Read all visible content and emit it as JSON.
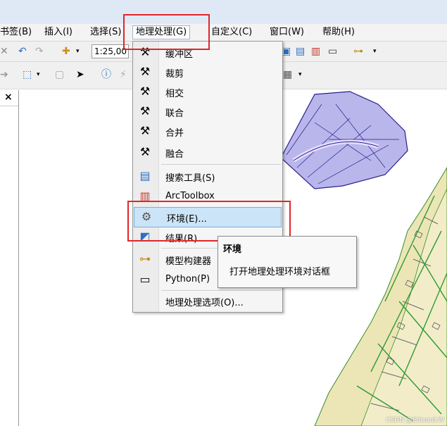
{
  "menubar": {
    "items": [
      "书签(B)",
      "插入(I)",
      "选择(S)",
      "地理处理(G)",
      "自定义(C)",
      "窗口(W)",
      "帮助(H)"
    ]
  },
  "toolbar": {
    "scale_value": "1:25,00"
  },
  "toc": {
    "close_glyph": "×"
  },
  "geoprocessing_menu": {
    "items": [
      {
        "label": "缓冲区",
        "icon": "hammer-icon"
      },
      {
        "label": "裁剪",
        "icon": "hammer-icon"
      },
      {
        "label": "相交",
        "icon": "hammer-icon"
      },
      {
        "label": "联合",
        "icon": "hammer-icon"
      },
      {
        "label": "合并",
        "icon": "hammer-icon"
      },
      {
        "label": "融合",
        "icon": "hammer-icon"
      },
      {
        "label": "搜索工具(S)",
        "icon": "search-window-icon"
      },
      {
        "label": "ArcToolbox",
        "icon": "toolbox-icon"
      },
      {
        "label": "环境(E)...",
        "icon": "tools-wrench-icon"
      },
      {
        "label": "结果(R)",
        "icon": "results-icon"
      },
      {
        "label": "模型构建器",
        "icon": "model-builder-icon"
      },
      {
        "label": "Python(P)",
        "icon": "python-window-icon"
      },
      {
        "label": "地理处理选项(O)...",
        "icon": ""
      }
    ],
    "highlighted": "环境(E)..."
  },
  "tooltip": {
    "title": "环境",
    "description": "打开地理处理环境对话框"
  },
  "watermark": "CSDN @Edward.W"
}
